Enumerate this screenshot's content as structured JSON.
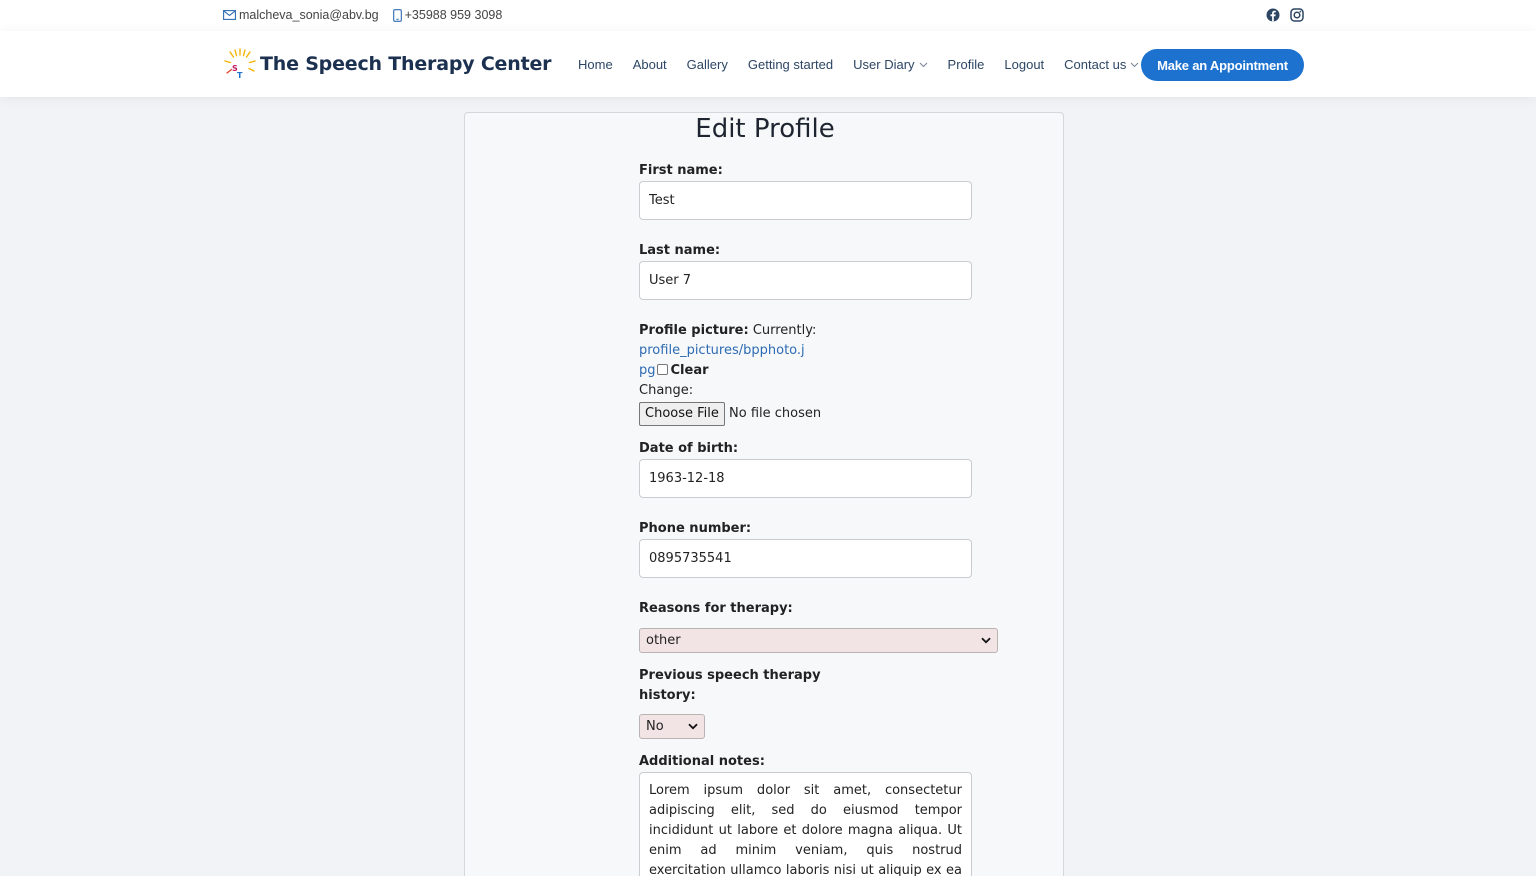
{
  "topbar": {
    "email": "malcheva_sonia@abv.bg",
    "phone": "+35988 959 3098",
    "social_icons": [
      "facebook-icon",
      "instagram-icon"
    ]
  },
  "header": {
    "brand_name": "The Speech Therapy Center",
    "nav": [
      {
        "label": "Home"
      },
      {
        "label": "About"
      },
      {
        "label": "Gallery"
      },
      {
        "label": "Getting started"
      },
      {
        "label": "User Diary",
        "dropdown": true
      },
      {
        "label": "Profile"
      },
      {
        "label": "Logout"
      },
      {
        "label": "Contact us",
        "dropdown": true
      }
    ],
    "cta_label": "Make an Appointment",
    "accent_color": "#1d72cf"
  },
  "form": {
    "title": "Edit Profile",
    "first_name": {
      "label": "First name:",
      "value": "Test"
    },
    "last_name": {
      "label": "Last name:",
      "value": "User 7"
    },
    "profile_picture": {
      "label": "Profile picture:",
      "currently_label": "Currently:",
      "link_part1": "profile_pictures/bpphoto.j",
      "link_part2": "pg",
      "clear_label": "Clear",
      "change_label": "Change:",
      "choose_file_label": "Choose File",
      "no_file_text": "No file chosen"
    },
    "date_of_birth": {
      "label": "Date of birth:",
      "value": "1963-12-18"
    },
    "phone_number": {
      "label": "Phone number:",
      "value": "0895735541"
    },
    "reasons": {
      "label": "Reasons for therapy:",
      "value": "other"
    },
    "previous_history": {
      "label_line1": "Previous speech therapy",
      "label_line2": "history:",
      "value": "No"
    },
    "notes": {
      "label": "Additional notes:",
      "value": "Lorem ipsum dolor sit amet, consectetur adipiscing elit, sed do eiusmod tempor incididunt ut labore et dolore magna aliqua. Ut enim ad minim veniam, quis nostrud exercitation ullamco laboris nisi ut aliquip ex ea commodo consequat."
    }
  }
}
